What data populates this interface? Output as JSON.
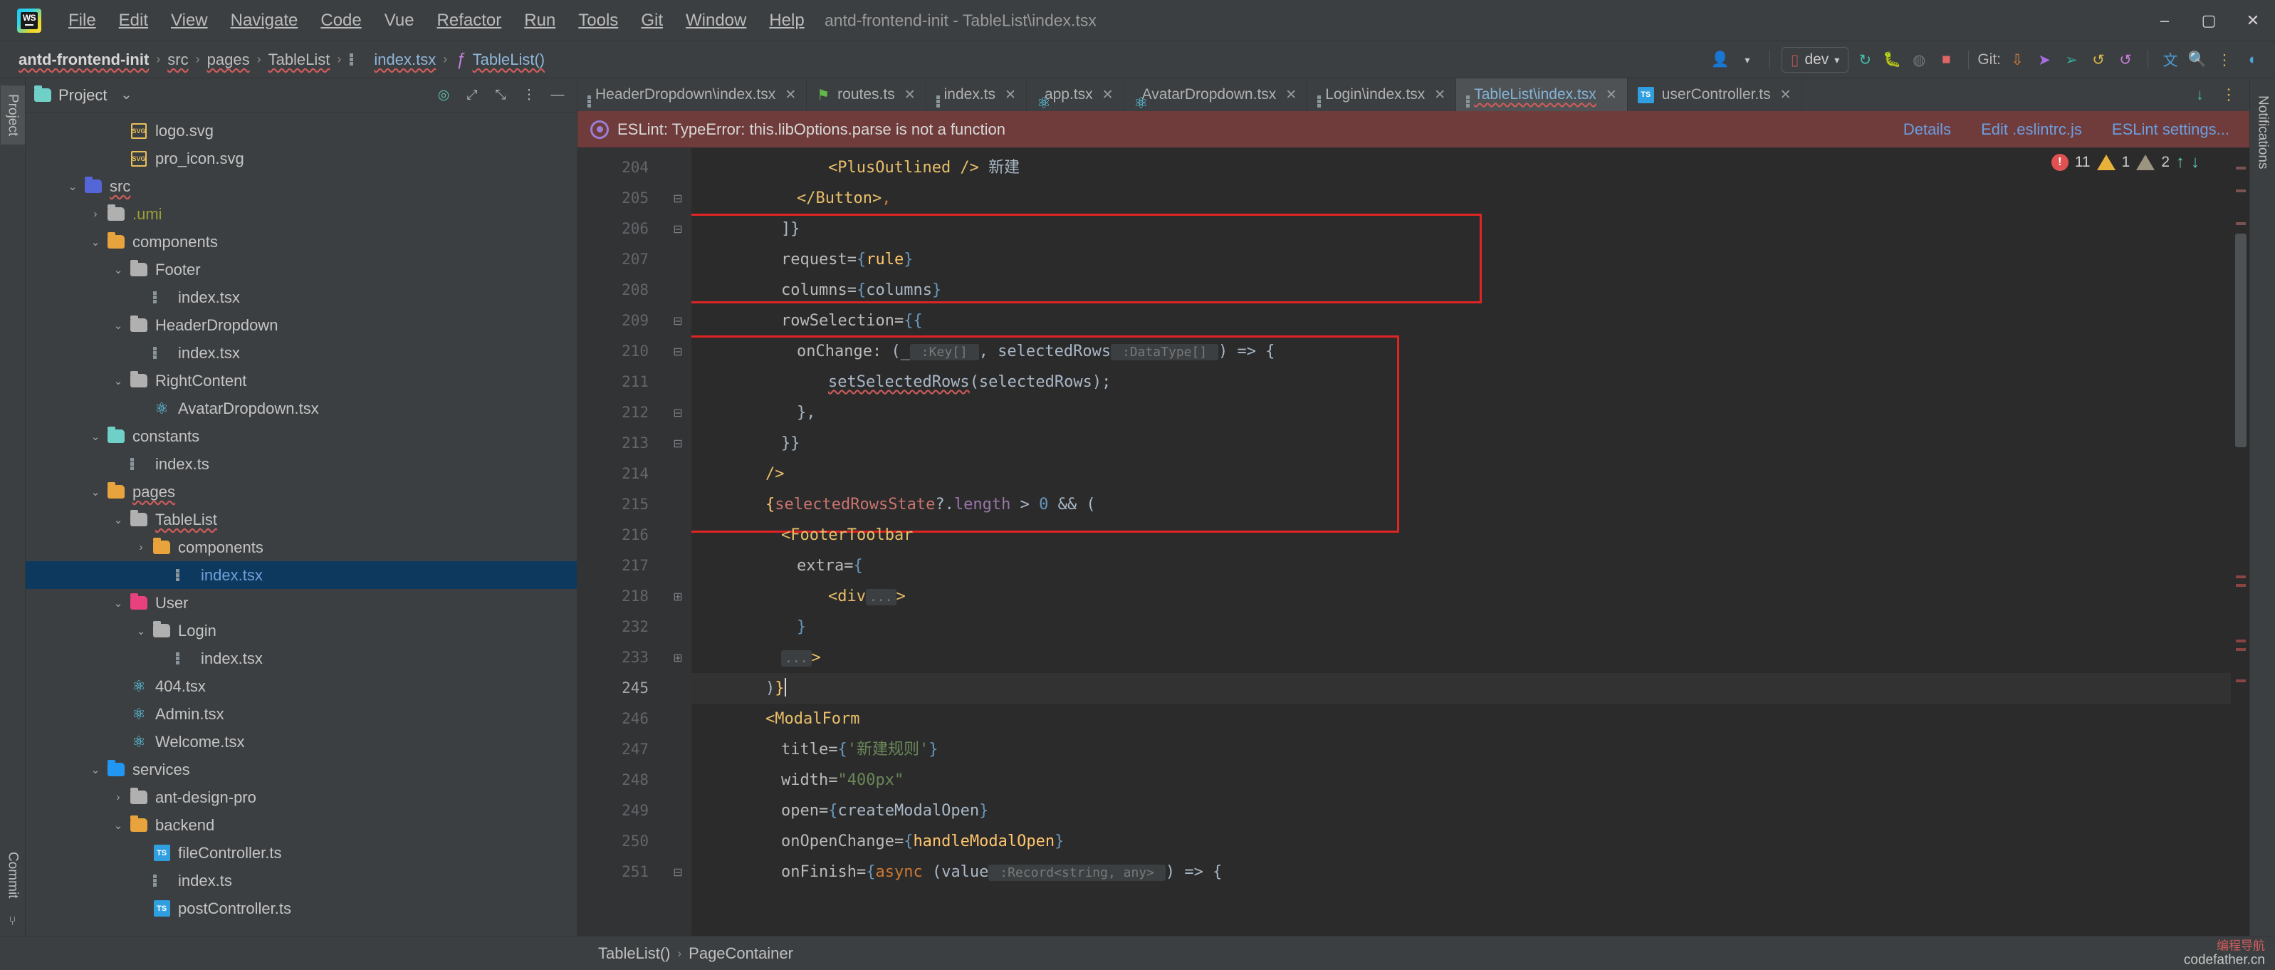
{
  "titlebar": {
    "logo": "webstorm-logo",
    "menus": [
      "File",
      "Edit",
      "View",
      "Navigate",
      "Code",
      "Vue",
      "Refactor",
      "Run",
      "Tools",
      "Git",
      "Window",
      "Help"
    ],
    "window_title": "antd-frontend-init - TableList\\index.tsx",
    "minimize": "–",
    "maximize": "▢",
    "close": "✕"
  },
  "navbar": {
    "breadcrumb": [
      {
        "label": "antd-frontend-init",
        "style": "bold"
      },
      {
        "label": "src",
        "style": "plain"
      },
      {
        "label": "pages",
        "style": "plain"
      },
      {
        "label": "TableList",
        "style": "plain"
      },
      {
        "label": "index.tsx",
        "style": "link",
        "icon": "tsx-file-icon"
      },
      {
        "label": "TableList()",
        "style": "link",
        "icon": "function-icon"
      }
    ],
    "separator": "›",
    "run_config": "dev",
    "git_label": "Git:",
    "icons": [
      "user-avatar-icon",
      "chevron-down-icon",
      "run-config-icon",
      "rerun-icon",
      "debug-icon",
      "coverage-icon",
      "stop-icon",
      "git-update-icon",
      "git-push-icon",
      "git-commit-icon",
      "git-history-icon",
      "git-rollback-icon",
      "translate-icon",
      "search-icon",
      "more-options-icon",
      "ai-assistant-icon"
    ]
  },
  "left_rail": {
    "tabs": [
      "Project",
      "Commit"
    ],
    "active": "Project"
  },
  "right_rail": {
    "tabs": [
      "Notifications"
    ]
  },
  "project_panel": {
    "title": "Project",
    "dropdown": "⌄",
    "header_icons": [
      "target-icon",
      "expand-icon",
      "collapse-all-icon",
      "more-options-icon",
      "hide-icon"
    ],
    "tree": [
      {
        "depth": 3,
        "arrow": "",
        "icon": "svg-file-icon",
        "label": "logo.svg",
        "style": "plain"
      },
      {
        "depth": 3,
        "arrow": "",
        "icon": "svg-file-icon",
        "label": "pro_icon.svg",
        "style": "plain"
      },
      {
        "depth": 1,
        "arrow": "⌄",
        "icon": "folder-src-icon",
        "label": "src",
        "style": "squiggle"
      },
      {
        "depth": 2,
        "arrow": "›",
        "icon": "folder-icon",
        "label": ".umi",
        "style": "olive"
      },
      {
        "depth": 2,
        "arrow": "⌄",
        "icon": "folder-components-icon",
        "label": "components",
        "style": "plain"
      },
      {
        "depth": 3,
        "arrow": "⌄",
        "icon": "folder-icon",
        "label": "Footer",
        "style": "plain"
      },
      {
        "depth": 4,
        "arrow": "",
        "icon": "tsx-file-icon",
        "label": "index.tsx",
        "style": "plain"
      },
      {
        "depth": 3,
        "arrow": "⌄",
        "icon": "folder-icon",
        "label": "HeaderDropdown",
        "style": "plain"
      },
      {
        "depth": 4,
        "arrow": "",
        "icon": "tsx-file-icon",
        "label": "index.tsx",
        "style": "plain"
      },
      {
        "depth": 3,
        "arrow": "⌄",
        "icon": "folder-icon",
        "label": "RightContent",
        "style": "plain"
      },
      {
        "depth": 4,
        "arrow": "",
        "icon": "react-file-icon",
        "label": "AvatarDropdown.tsx",
        "style": "plain"
      },
      {
        "depth": 2,
        "arrow": "⌄",
        "icon": "folder-constants-icon",
        "label": "constants",
        "style": "plain"
      },
      {
        "depth": 3,
        "arrow": "",
        "icon": "ts-list-file-icon",
        "label": "index.ts",
        "style": "plain"
      },
      {
        "depth": 2,
        "arrow": "⌄",
        "icon": "folder-pages-icon",
        "label": "pages",
        "style": "squiggle"
      },
      {
        "depth": 3,
        "arrow": "⌄",
        "icon": "folder-icon",
        "label": "TableList",
        "style": "squiggle"
      },
      {
        "depth": 4,
        "arrow": "›",
        "icon": "folder-components-icon",
        "label": "components",
        "style": "plain"
      },
      {
        "depth": 5,
        "arrow": "",
        "icon": "tsx-file-icon",
        "label": "index.tsx",
        "style": "selected"
      },
      {
        "depth": 3,
        "arrow": "⌄",
        "icon": "folder-user-icon",
        "label": "User",
        "style": "plain"
      },
      {
        "depth": 4,
        "arrow": "⌄",
        "icon": "folder-icon",
        "label": "Login",
        "style": "plain"
      },
      {
        "depth": 5,
        "arrow": "",
        "icon": "tsx-file-icon",
        "label": "index.tsx",
        "style": "plain"
      },
      {
        "depth": 3,
        "arrow": "",
        "icon": "react-file-icon",
        "label": "404.tsx",
        "style": "plain"
      },
      {
        "depth": 3,
        "arrow": "",
        "icon": "react-file-icon",
        "label": "Admin.tsx",
        "style": "plain"
      },
      {
        "depth": 3,
        "arrow": "",
        "icon": "react-file-icon",
        "label": "Welcome.tsx",
        "style": "plain"
      },
      {
        "depth": 2,
        "arrow": "⌄",
        "icon": "folder-services-icon",
        "label": "services",
        "style": "plain"
      },
      {
        "depth": 3,
        "arrow": "›",
        "icon": "folder-icon",
        "label": "ant-design-pro",
        "style": "plain"
      },
      {
        "depth": 3,
        "arrow": "⌄",
        "icon": "folder-backend-icon",
        "label": "backend",
        "style": "plain"
      },
      {
        "depth": 4,
        "arrow": "",
        "icon": "ts-file-icon",
        "label": "fileController.ts",
        "style": "plain"
      },
      {
        "depth": 4,
        "arrow": "",
        "icon": "ts-list-file-icon",
        "label": "index.ts",
        "style": "plain"
      },
      {
        "depth": 4,
        "arrow": "",
        "icon": "ts-file-icon",
        "label": "postController.ts",
        "style": "plain"
      }
    ]
  },
  "editor_tabs": {
    "items": [
      {
        "label": "HeaderDropdown\\index.tsx",
        "icon": "tsx-file-icon",
        "active": false
      },
      {
        "label": "routes.ts",
        "icon": "routes-file-icon",
        "active": false
      },
      {
        "label": "index.ts",
        "icon": "tsx-file-icon",
        "active": false
      },
      {
        "label": "app.tsx",
        "icon": "react-file-icon",
        "active": false
      },
      {
        "label": "AvatarDropdown.tsx",
        "icon": "react-file-icon",
        "active": false
      },
      {
        "label": "Login\\index.tsx",
        "icon": "tsx-file-icon",
        "active": false
      },
      {
        "label": "TableList\\index.tsx",
        "icon": "tsx-file-icon",
        "active": true
      },
      {
        "label": "userController.ts",
        "icon": "ts-file-icon",
        "active": false
      }
    ],
    "close_label": "✕",
    "right_icons": [
      "scroll-down-icon",
      "tab-options-icon"
    ]
  },
  "error_banner": {
    "icon": "eslint-icon",
    "message": "ESLint: TypeError: this.libOptions.parse is not a function",
    "actions": [
      "Details",
      "Edit .eslintrc.js",
      "ESLint settings..."
    ]
  },
  "inspection_widget": {
    "errors": "11",
    "warnings": "1",
    "weak_warnings": "2",
    "prev": "↑",
    "next": "↓"
  },
  "code": {
    "lines": [
      {
        "no": "204",
        "fold": "",
        "indent": 8,
        "tokens": [
          {
            "t": "<PlusOutlined />",
            "c": "tag"
          },
          {
            "t": " 新建",
            "c": "var"
          }
        ]
      },
      {
        "no": "205",
        "fold": "⊟",
        "indent": 6,
        "tokens": [
          {
            "t": "</Button>",
            "c": "tag"
          },
          {
            "t": ",",
            "c": "kw"
          }
        ]
      },
      {
        "no": "206",
        "fold": "⊟",
        "indent": 5,
        "tokens": [
          {
            "t": "]}",
            "c": "var"
          }
        ]
      },
      {
        "no": "207",
        "fold": "",
        "indent": 5,
        "tokens": [
          {
            "t": "request=",
            "c": "attr"
          },
          {
            "t": "{",
            "c": "num"
          },
          {
            "t": "rule",
            "c": "fn"
          },
          {
            "t": "}",
            "c": "num"
          }
        ]
      },
      {
        "no": "208",
        "fold": "",
        "indent": 5,
        "tokens": [
          {
            "t": "columns=",
            "c": "attr"
          },
          {
            "t": "{",
            "c": "num"
          },
          {
            "t": "columns",
            "c": "var"
          },
          {
            "t": "}",
            "c": "num"
          }
        ]
      },
      {
        "no": "209",
        "fold": "⊟",
        "indent": 5,
        "tokens": [
          {
            "t": "rowSelection=",
            "c": "attr"
          },
          {
            "t": "{{",
            "c": "num"
          }
        ]
      },
      {
        "no": "210",
        "fold": "⊟",
        "indent": 6,
        "tokens": [
          {
            "t": "onChange",
            "c": "attr"
          },
          {
            "t": ": (",
            "c": "var"
          },
          {
            "t": "_",
            "c": "var"
          },
          {
            "t": " :Key[] ",
            "c": "hint"
          },
          {
            "t": ", ",
            "c": "var"
          },
          {
            "t": "selectedRows",
            "c": "var"
          },
          {
            "t": " :DataType[] ",
            "c": "hint"
          },
          {
            "t": ") => {",
            "c": "var"
          }
        ]
      },
      {
        "no": "211",
        "fold": "",
        "indent": 8,
        "tokens": [
          {
            "t": "setSelectedRows",
            "c": "squig"
          },
          {
            "t": "(selectedRows);",
            "c": "var"
          }
        ]
      },
      {
        "no": "212",
        "fold": "⊟",
        "indent": 6,
        "tokens": [
          {
            "t": "},",
            "c": "var"
          }
        ]
      },
      {
        "no": "213",
        "fold": "⊟",
        "indent": 5,
        "tokens": [
          {
            "t": "}}",
            "c": "var"
          }
        ]
      },
      {
        "no": "214",
        "fold": "",
        "indent": 4,
        "tokens": [
          {
            "t": "/>",
            "c": "tag"
          }
        ]
      },
      {
        "no": "215",
        "fold": "",
        "indent": 4,
        "tokens": [
          {
            "t": "{",
            "c": "fn"
          },
          {
            "t": "selectedRowsState",
            "c": "prop-red"
          },
          {
            "t": "?.",
            "c": "var"
          },
          {
            "t": "length",
            "c": "prop"
          },
          {
            "t": " > ",
            "c": "var"
          },
          {
            "t": "0",
            "c": "num"
          },
          {
            "t": " && (",
            "c": "var"
          }
        ]
      },
      {
        "no": "216",
        "fold": "",
        "indent": 5,
        "tokens": [
          {
            "t": "<FooterToolbar",
            "c": "tag"
          }
        ]
      },
      {
        "no": "217",
        "fold": "",
        "indent": 6,
        "tokens": [
          {
            "t": "extra=",
            "c": "attr"
          },
          {
            "t": "{",
            "c": "num"
          }
        ]
      },
      {
        "no": "218",
        "fold": "⊞",
        "indent": 8,
        "tokens": [
          {
            "t": "<div",
            "c": "tag"
          },
          {
            "t": "...",
            "c": "hint"
          },
          {
            "t": ">",
            "c": "tag"
          }
        ]
      },
      {
        "no": "232",
        "fold": "",
        "indent": 6,
        "tokens": [
          {
            "t": "}",
            "c": "num"
          }
        ]
      },
      {
        "no": "233",
        "fold": "⊞",
        "indent": 5,
        "tokens": [
          {
            "t": "...",
            "c": "hint"
          },
          {
            "t": ">",
            "c": "tag"
          }
        ]
      },
      {
        "no": "245",
        "fold": "",
        "indent": 4,
        "tokens": [
          {
            "t": ")",
            "c": "var"
          },
          {
            "t": "}",
            "c": "fn"
          }
        ],
        "current": true
      },
      {
        "no": "246",
        "fold": "",
        "indent": 4,
        "tokens": [
          {
            "t": "<ModalForm",
            "c": "tag"
          }
        ]
      },
      {
        "no": "247",
        "fold": "",
        "indent": 5,
        "tokens": [
          {
            "t": "title=",
            "c": "attr"
          },
          {
            "t": "{",
            "c": "num"
          },
          {
            "t": "'新建规则'",
            "c": "str"
          },
          {
            "t": "}",
            "c": "num"
          }
        ]
      },
      {
        "no": "248",
        "fold": "",
        "indent": 5,
        "tokens": [
          {
            "t": "width=",
            "c": "attr"
          },
          {
            "t": "\"400px\"",
            "c": "str"
          }
        ]
      },
      {
        "no": "249",
        "fold": "",
        "indent": 5,
        "tokens": [
          {
            "t": "open=",
            "c": "attr"
          },
          {
            "t": "{",
            "c": "num"
          },
          {
            "t": "createModalOpen",
            "c": "var"
          },
          {
            "t": "}",
            "c": "num"
          }
        ]
      },
      {
        "no": "250",
        "fold": "",
        "indent": 5,
        "tokens": [
          {
            "t": "onOpenChange=",
            "c": "attr"
          },
          {
            "t": "{",
            "c": "num"
          },
          {
            "t": "handleModalOpen",
            "c": "fn"
          },
          {
            "t": "}",
            "c": "num"
          }
        ]
      },
      {
        "no": "251",
        "fold": "⊟",
        "indent": 5,
        "tokens": [
          {
            "t": "onFinish=",
            "c": "attr"
          },
          {
            "t": "{",
            "c": "num"
          },
          {
            "t": "async",
            "c": "kw"
          },
          {
            "t": " (value",
            "c": "var"
          },
          {
            "t": " :Record<string, any> ",
            "c": "hint"
          },
          {
            "t": ") => {",
            "c": "var"
          }
        ]
      }
    ]
  },
  "status_bar": {
    "breadcrumb": [
      "TableList()",
      "PageContainer"
    ],
    "separator": "›"
  },
  "watermark": {
    "line1": "编程导航",
    "line2": "codefather.cn"
  },
  "colors": {
    "accent_blue": "#6f9fd8",
    "error_red": "#e02424",
    "banner_bg": "#6f3b3b",
    "selection_blue": "#0d395f",
    "editor_bg": "#2b2b2b",
    "chrome_bg": "#3c3f41"
  }
}
